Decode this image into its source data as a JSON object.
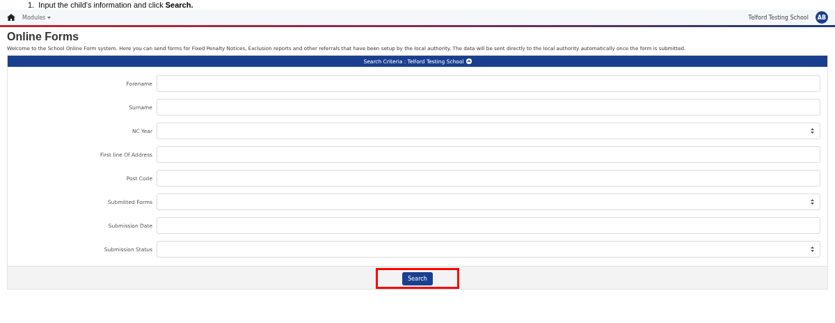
{
  "instruction": "1.  Input the child's information and click **Search.**",
  "navbar": {
    "menu": "Modules",
    "school": "Telford Testing School",
    "avatar": "AB"
  },
  "page": {
    "title": "Online Forms",
    "description": "Welcome to the School Online Form system. Here you can send forms for Fixed Penalty Notices, Exclusion reports and other referrals that have been setup by the local authority. The data will be sent directly to the local authority automatically once the form is submitted."
  },
  "panel": {
    "title": "Search Criteria : Telford Testing School",
    "expanded": true
  },
  "fields": [
    {
      "label": "Forename",
      "kind": "text"
    },
    {
      "label": "Surname",
      "kind": "text"
    },
    {
      "label": "NC Year",
      "kind": "select"
    },
    {
      "label": "First line Of Address",
      "kind": "text"
    },
    {
      "label": "Post Code",
      "kind": "text"
    },
    {
      "label": "Submitted Forms",
      "kind": "select"
    },
    {
      "label": "Submission Date",
      "kind": "text"
    },
    {
      "label": "Submission Status",
      "kind": "select"
    }
  ],
  "search_button": {
    "label": "Search",
    "highlighted": true
  }
}
